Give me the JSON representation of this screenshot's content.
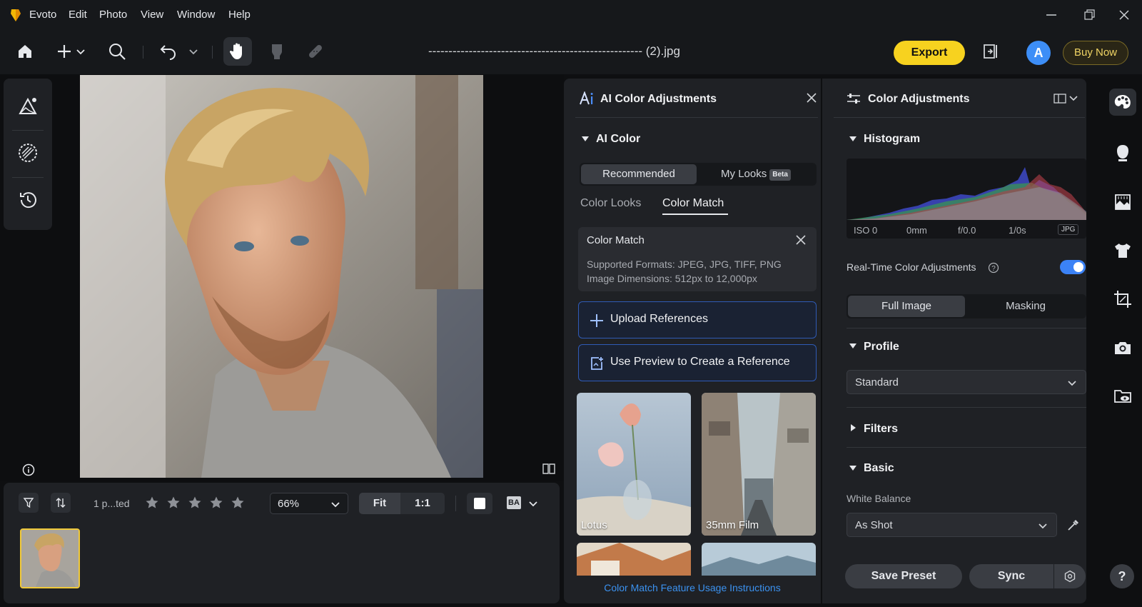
{
  "app": {
    "name": "Evoto",
    "menu": [
      "Edit",
      "Photo",
      "View",
      "Window",
      "Help"
    ]
  },
  "toolbar": {
    "filename": "----------------------------------------------------- (2).jpg",
    "export_label": "Export",
    "avatar_letter": "A",
    "buy_now_label": "Buy Now",
    "icons": [
      "home-icon",
      "add-icon",
      "search-icon",
      "undo-icon",
      "hand-icon",
      "retouch-brush-icon",
      "bandage-icon"
    ]
  },
  "canvas": {
    "zoom": "66%",
    "fit_label": "Fit",
    "one_to_one_label": "1:1",
    "before_after_label": "BA"
  },
  "filmstrip": {
    "rated_label": "1 p...ted",
    "stars": 5
  },
  "ai_panel": {
    "title": "AI Color Adjustments",
    "section_title": "AI Color",
    "segment": {
      "recommended": "Recommended",
      "my_looks": "My Looks",
      "beta": "Beta"
    },
    "tabs": {
      "color_looks": "Color Looks",
      "color_match": "Color Match"
    },
    "color_match_box": {
      "title": "Color Match",
      "formats": "Supported Formats: JPEG, JPG, TIFF, PNG",
      "dimensions": "Image Dimensions: 512px to 12,000px"
    },
    "upload_label": "Upload References",
    "preview_label": "Use Preview to Create a Reference",
    "looks": [
      {
        "name": "Lotus"
      },
      {
        "name": "35mm Film"
      },
      {
        "name": ""
      },
      {
        "name": ""
      }
    ],
    "instructions_link": "Color Match Feature Usage Instructions"
  },
  "adj_panel": {
    "title": "Color Adjustments",
    "histogram_title": "Histogram",
    "exif": {
      "iso": "ISO 0",
      "focal": "0mm",
      "aperture": "f/0.0",
      "shutter": "1/0s",
      "format": "JPG"
    },
    "realtime_label": "Real-Time Color Adjustments",
    "realtime_on": true,
    "segment": {
      "full": "Full Image",
      "masking": "Masking"
    },
    "profile_title": "Profile",
    "profile_value": "Standard",
    "filters_title": "Filters",
    "basic_title": "Basic",
    "white_balance_label": "White Balance",
    "white_balance_value": "As Shot",
    "save_preset_label": "Save Preset",
    "sync_label": "Sync"
  },
  "right_rail": [
    "palette-icon",
    "face-icon",
    "background-icon",
    "clothing-icon",
    "crop-icon",
    "camera-icon",
    "folder-view-icon"
  ],
  "help_label": "?",
  "colors": {
    "accent": "#f7d21f",
    "blue": "#3b82f6",
    "panel": "#1f2125"
  }
}
